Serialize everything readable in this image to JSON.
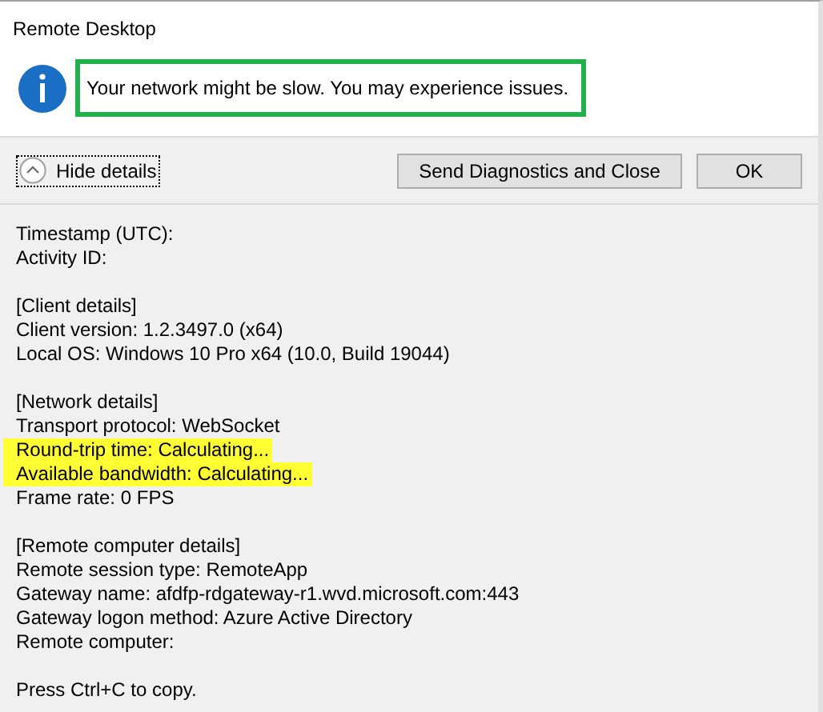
{
  "window": {
    "title": "Remote Desktop"
  },
  "message": {
    "text": "Your network might be slow. You may experience issues.",
    "outlined": true
  },
  "toggle": {
    "label": "Hide details",
    "expanded": true
  },
  "buttons": [
    {
      "label": "Send Diagnostics and Close"
    },
    {
      "label": "OK"
    }
  ],
  "details": [
    [
      {
        "text": "Timestamp (UTC):",
        "highlighted": false
      },
      {
        "text": "Activity ID:",
        "highlighted": false
      }
    ],
    [
      {
        "text": "[Client details]",
        "highlighted": false
      },
      {
        "text": "Client version: 1.2.3497.0 (x64)",
        "highlighted": false
      },
      {
        "text": "Local OS: Windows 10 Pro x64 (10.0, Build 19044)",
        "highlighted": false
      }
    ],
    [
      {
        "text": "[Network details]",
        "highlighted": false
      },
      {
        "text": "Transport protocol: WebSocket",
        "highlighted": false
      },
      {
        "text": "Round-trip time: Calculating...",
        "highlighted": true
      },
      {
        "text": "Available bandwidth: Calculating...",
        "highlighted": true
      },
      {
        "text": "Frame rate: 0 FPS",
        "highlighted": false
      }
    ],
    [
      {
        "text": "[Remote computer details]",
        "highlighted": false
      },
      {
        "text": "Remote session type: RemoteApp",
        "highlighted": false
      },
      {
        "text": "Gateway name: afdfp-rdgateway-r1.wvd.microsoft.com:443",
        "highlighted": false
      },
      {
        "text": "Gateway logon method: Azure Active Directory",
        "highlighted": false
      },
      {
        "text": "Remote computer:",
        "highlighted": false
      }
    ],
    [
      {
        "text": "Press Ctrl+C to copy.",
        "highlighted": false
      }
    ]
  ]
}
